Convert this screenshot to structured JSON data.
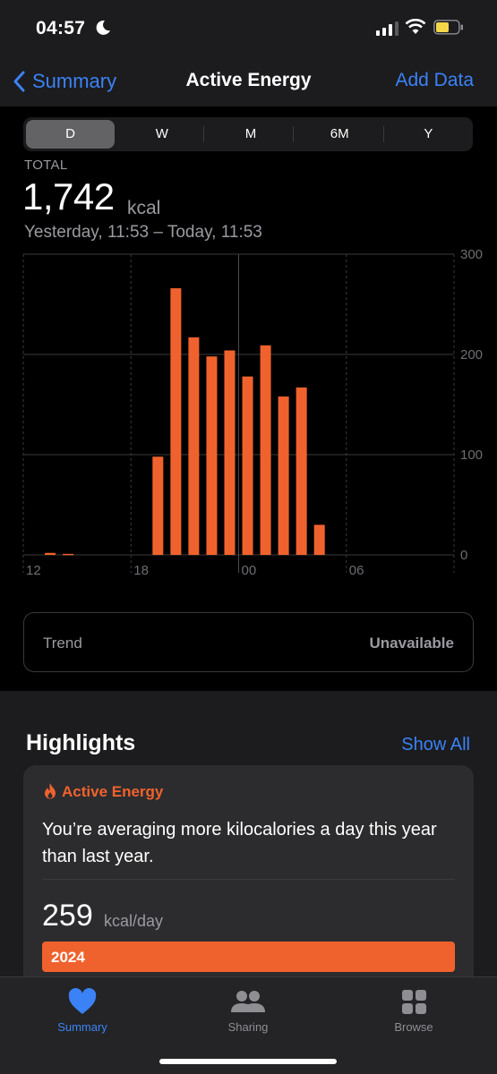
{
  "status_bar": {
    "time": "04:57"
  },
  "nav": {
    "back_label": "Summary",
    "title": "Active Energy",
    "action_label": "Add Data"
  },
  "range_tabs": [
    "D",
    "W",
    "M",
    "6M",
    "Y"
  ],
  "selected_range": "D",
  "total": {
    "label": "TOTAL",
    "value": "1,742",
    "unit": "kcal",
    "date_range": "Yesterday, 11:53 – Today, 11:53"
  },
  "chart_data": {
    "type": "bar",
    "x_tick_labels": [
      "12",
      "18",
      "00",
      "06"
    ],
    "y_tick_labels": [
      "300",
      "200",
      "100",
      "0"
    ],
    "ylim": [
      0,
      300
    ],
    "hours": [
      13,
      14,
      19,
      20,
      21,
      22,
      23,
      0,
      1,
      2,
      3,
      4
    ],
    "values": [
      2,
      1,
      98,
      266,
      217,
      198,
      204,
      178,
      209,
      158,
      167,
      30
    ],
    "bar_color": "#f0622d",
    "grid": true
  },
  "trend": {
    "label": "Trend",
    "value": "Unavailable"
  },
  "highlights": {
    "title": "Highlights",
    "show_all_label": "Show All",
    "card": {
      "category": "Active Energy",
      "text": "You’re averaging more kilocalories a day this year than last year.",
      "value": "259",
      "unit": "kcal/day",
      "bar_label": "2024"
    }
  },
  "tabs": [
    {
      "label": "Summary",
      "icon": "heart-icon",
      "active": true
    },
    {
      "label": "Sharing",
      "icon": "people-icon",
      "active": false
    },
    {
      "label": "Browse",
      "icon": "grid-icon",
      "active": false
    }
  ],
  "colors": {
    "accent": "#3b82f6",
    "energy": "#f0622d"
  }
}
